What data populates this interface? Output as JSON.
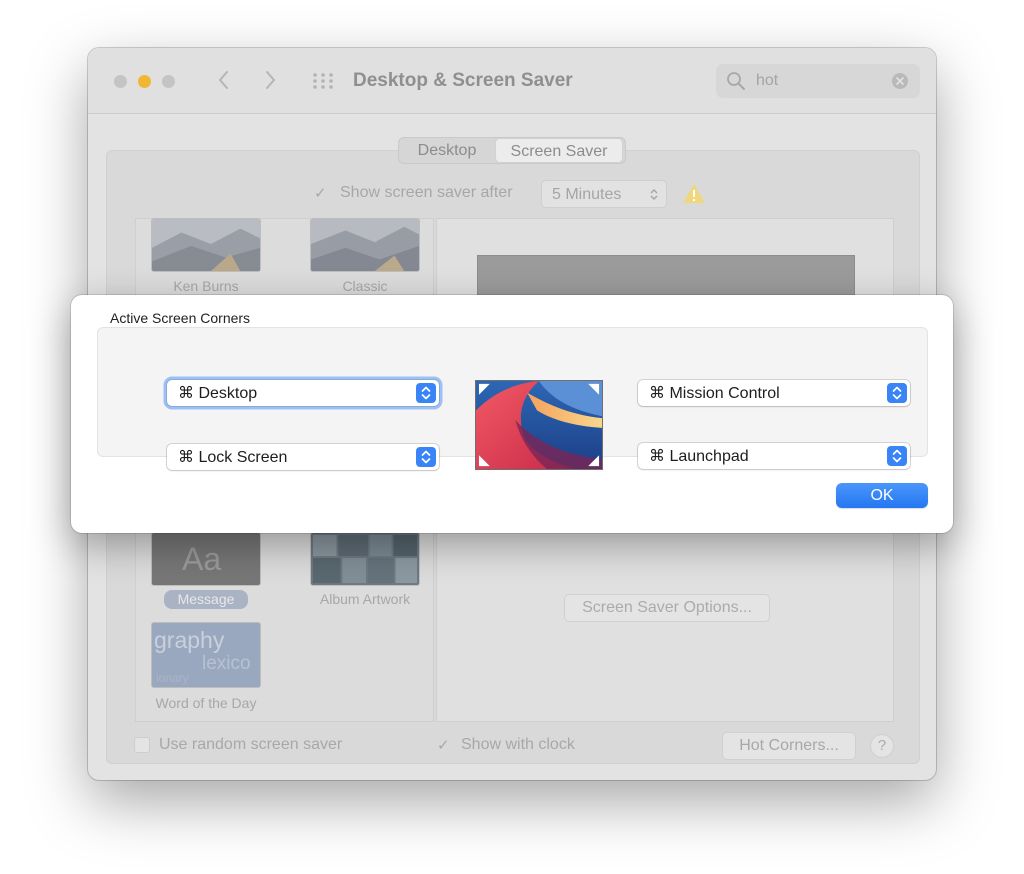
{
  "window": {
    "title": "Desktop & Screen Saver",
    "search": {
      "value": "hot"
    },
    "tabs": [
      {
        "label": "Desktop",
        "selected": false
      },
      {
        "label": "Screen Saver",
        "selected": true
      }
    ],
    "show_after": {
      "label": "Show screen saver after",
      "checked": true,
      "value": "5 Minutes"
    },
    "screen_savers": [
      {
        "label": "Ken Burns"
      },
      {
        "label": "Classic"
      },
      {
        "label": "Message",
        "thumb_text": "Aa",
        "selected": true
      },
      {
        "label": "Album Artwork"
      },
      {
        "label": "Word of the Day",
        "thumb_words": [
          "graphy",
          "lexico",
          "ionary"
        ]
      }
    ],
    "options_button": "Screen Saver Options...",
    "random": {
      "label": "Use random screen saver",
      "checked": false
    },
    "clock": {
      "label": "Show with clock",
      "checked": true
    },
    "hot_corners_button": "Hot Corners...",
    "help": "?"
  },
  "sheet": {
    "title": "Active Screen Corners",
    "corners": {
      "top_left": "⌘ Desktop",
      "bottom_left": "⌘ Lock Screen",
      "top_right": "⌘ Mission Control",
      "bottom_right": "⌘ Launchpad"
    },
    "ok_label": "OK"
  },
  "colors": {
    "accent": "#3a85f6",
    "focus_ring": "#9cc1f5",
    "traffic_yellow": "#f0b733"
  },
  "icons": [
    "chevron-left-icon",
    "chevron-right-icon",
    "grid-icon",
    "search-icon",
    "clear-icon",
    "checkmark-icon",
    "warning-icon",
    "updown-chevron-icon",
    "corner-arrow-icon"
  ]
}
